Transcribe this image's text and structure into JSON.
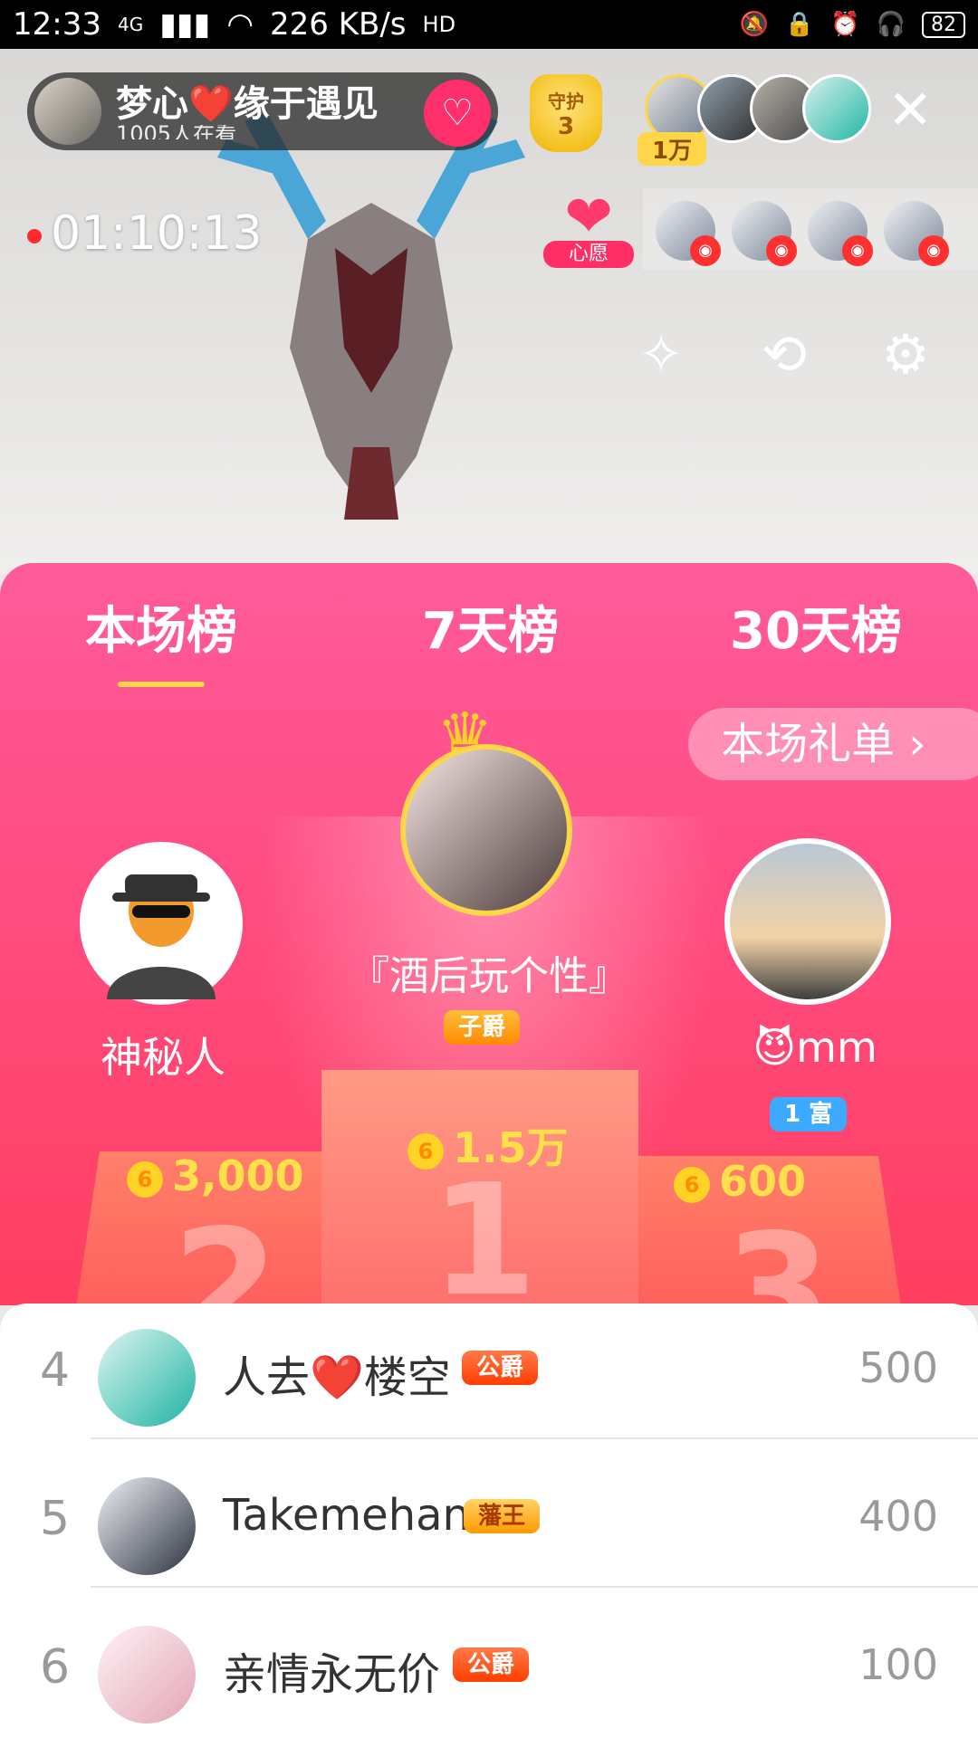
{
  "statusbar": {
    "time": "12:33",
    "network": "4G",
    "speed": "226 KB/s",
    "hd": "HD",
    "battery": "82"
  },
  "host": {
    "name": "梦心❤️缘于遇见",
    "viewers": "1005人在看"
  },
  "guard": {
    "label": "守护",
    "count": "3"
  },
  "viewers_badge": "1万",
  "timer": "01:10:13",
  "wish": {
    "label": "心愿"
  },
  "tabs": [
    {
      "label": "本场榜",
      "active": true
    },
    {
      "label": "7天榜",
      "active": false
    },
    {
      "label": "30天榜",
      "active": false
    }
  ],
  "gift_list_button": "本场礼单 ›",
  "top3": {
    "first": {
      "name": "『酒后玩个性』",
      "badge": "子爵",
      "coins": "1.5万",
      "podium": "1"
    },
    "second": {
      "name": "神秘人",
      "coins": "3,000",
      "podium": "2"
    },
    "third": {
      "name": "😈mm",
      "badge": "1 富",
      "coins": "600",
      "podium": "3"
    }
  },
  "ranking": [
    {
      "rank": "4",
      "name": "人去❤️楼空",
      "badge": "公爵",
      "value": "500"
    },
    {
      "rank": "5",
      "name": "Takemehan",
      "badge": "藩王",
      "value": "400"
    },
    {
      "rank": "6",
      "name": "亲情永无价",
      "badge": "公爵",
      "value": "100"
    }
  ],
  "icons": {
    "coin": "coin-icon",
    "close": "close-icon",
    "magic": "magic-wand-icon",
    "camera": "camera-switch-icon",
    "settings": "gear-icon"
  },
  "colors": {
    "panel_top": "#ff5b9a",
    "panel_bottom": "#ff3f60",
    "tab_underline": "#ffd54a",
    "coin_text": "#ffe04b"
  }
}
